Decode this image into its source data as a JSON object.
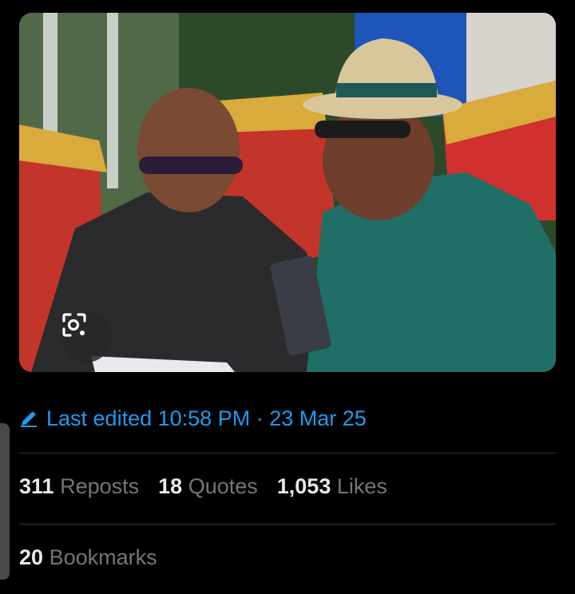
{
  "post": {
    "image_alt": "photo",
    "edited": {
      "label": "Last edited",
      "time": "10:58 PM",
      "sep": "·",
      "date": "23 Mar 25"
    },
    "stats": [
      {
        "num": "311",
        "label": "Reposts"
      },
      {
        "num": "18",
        "label": "Quotes"
      },
      {
        "num": "1,053",
        "label": "Likes"
      }
    ],
    "bookmarks": {
      "num": "20",
      "label": "Bookmarks"
    }
  },
  "colors": {
    "accent": "#1d9bf0",
    "muted": "#71767b",
    "text": "#e7e9ea",
    "divider": "#2f3336"
  },
  "icons": {
    "lens": "visual-search-icon",
    "pen": "edit-pencil-icon"
  }
}
